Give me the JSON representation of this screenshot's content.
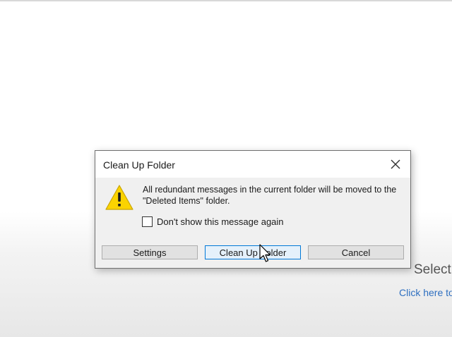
{
  "background": {
    "select_text": "Select",
    "click_link": "Click here to"
  },
  "dialog": {
    "title": "Clean Up Folder",
    "message": "All redundant messages in the current folder will be moved to the \"Deleted Items\" folder.",
    "checkbox_label": "Don't show this message again",
    "checkbox_checked": false,
    "buttons": {
      "settings": "Settings",
      "clean_up": "Clean Up Folder",
      "cancel": "Cancel"
    },
    "icons": {
      "warning": "warning-icon",
      "close": "close-icon"
    }
  },
  "colors": {
    "warning_fill": "#fbd300",
    "focus_border": "#0078d7",
    "link": "#2e6fc0"
  }
}
